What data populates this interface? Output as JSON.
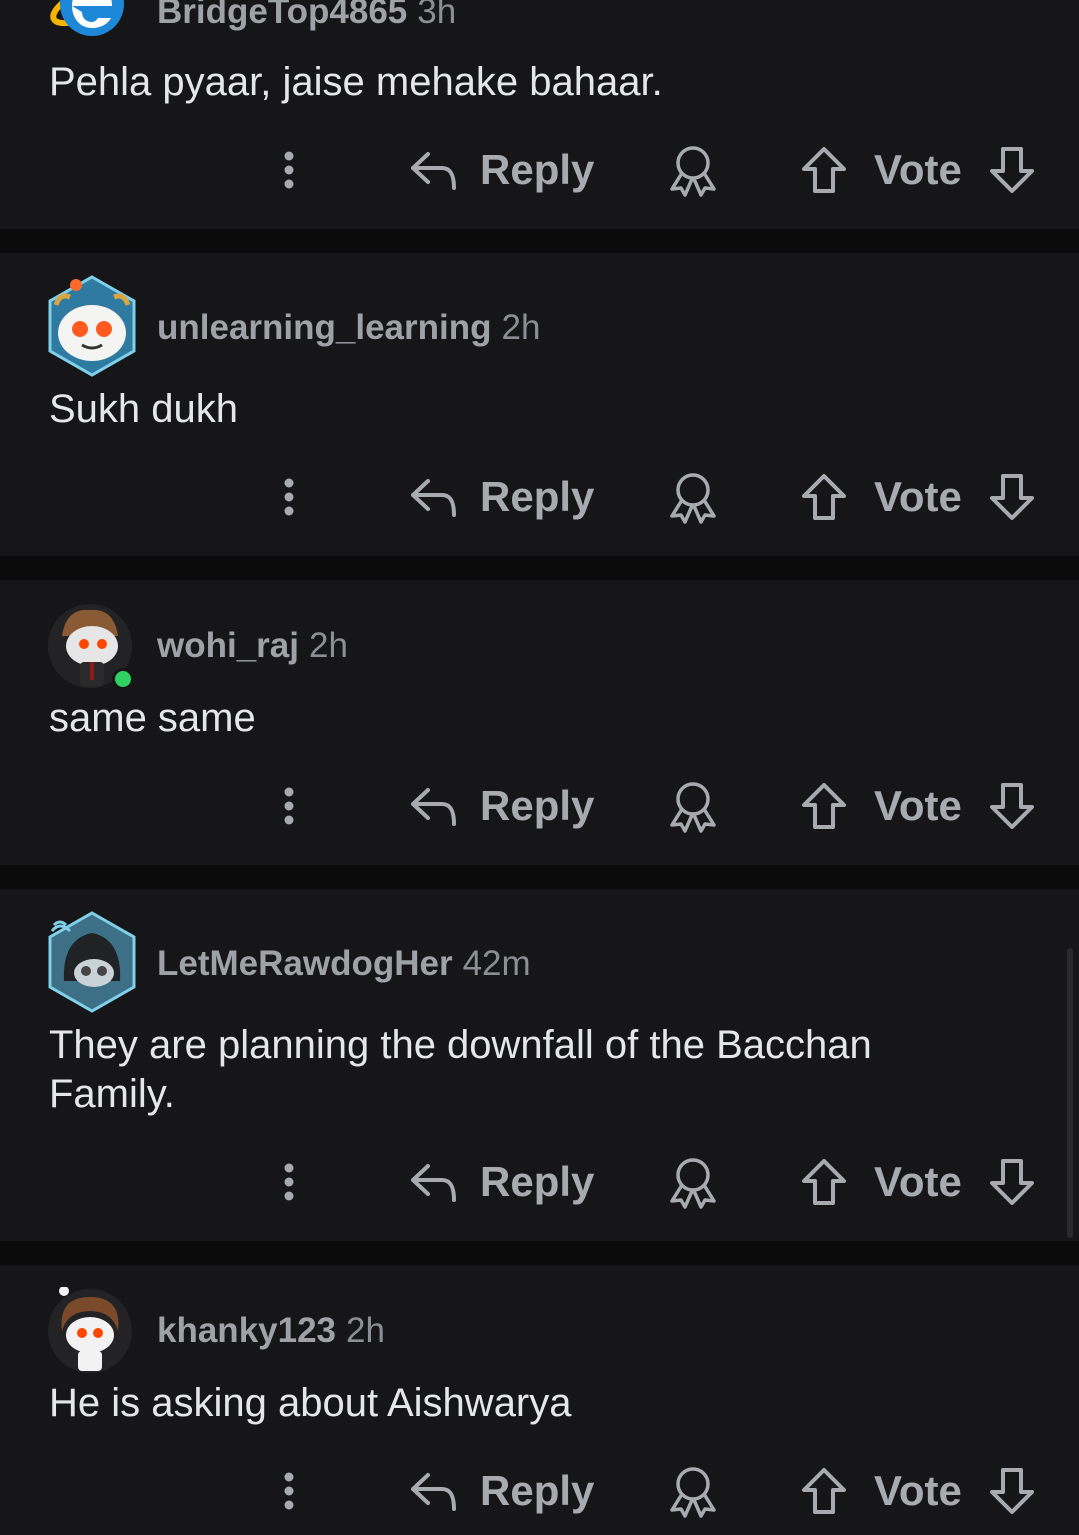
{
  "actions": {
    "reply_label": "Reply",
    "vote_label": "Vote"
  },
  "comments": [
    {
      "username": "BridgeTop4865",
      "age": "3h",
      "body": "Pehla pyaar, jaise mehake bahaar.",
      "avatar_icon": "internet-explorer-logo-icon"
    },
    {
      "username": "unlearning_learning",
      "age": "2h",
      "body": "Sukh dukh",
      "avatar_icon": "snoo-creature-avatar-icon"
    },
    {
      "username": "wohi_raj",
      "age": "2h",
      "body": "same same",
      "avatar_icon": "snoo-owl-hat-avatar-icon",
      "online": true
    },
    {
      "username": "LetMeRawdogHer",
      "age": "42m",
      "body": "They are planning the downfall of the Bacchan Family.",
      "avatar_icon": "snoo-hooded-mask-avatar-icon"
    },
    {
      "username": "khanky123",
      "age": "2h",
      "body": "He is asking about Aishwarya",
      "avatar_icon": "snoo-brown-hair-avatar-icon"
    }
  ],
  "colors": {
    "background": "#0b0b0c",
    "card": "#161618",
    "online": "#2fd161"
  }
}
